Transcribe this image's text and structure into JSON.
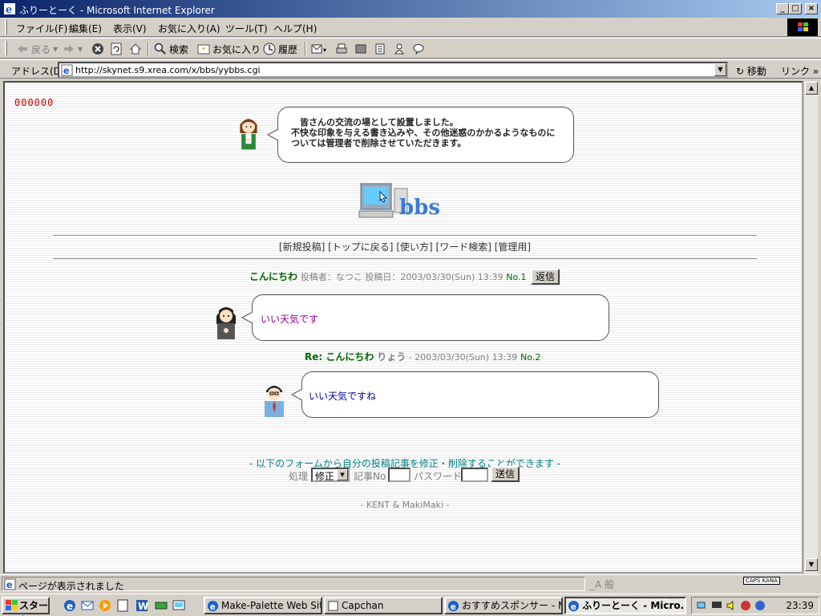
{
  "window": {
    "title": "ふりーとーく - Microsoft Internet Explorer",
    "minimize": "_",
    "maximize": "□",
    "close": "×"
  },
  "menu": [
    "ファイル(F)",
    "編集(E)",
    "表示(V)",
    "お気に入り(A)",
    "ツール(T)",
    "ヘルプ(H)"
  ],
  "toolbar": {
    "back": "戻る",
    "search": "検索",
    "favorites": "お気に入り",
    "history": "履歴"
  },
  "address": {
    "label": "アドレス(D)",
    "url": "http://skynet.s9.xrea.com/x/bbs/yybbs.cgi",
    "go": "移動",
    "links": "リンク »"
  },
  "page": {
    "counter": "000000",
    "welcome": "　皆さんの交流の場として設置しました。\n不快な印象を与える書き込みや、その他迷惑のかかるようなものについては管理者で削除させていただきます。",
    "logo_text": "bbs",
    "nav": [
      "[新規投稿]",
      "[トップに戻る]",
      "[使い方]",
      "[ワード検索]",
      "[管理用]"
    ],
    "posts": [
      {
        "subject": "こんにちわ",
        "meta_label_author": "投稿者：",
        "author": "なつこ",
        "meta_label_date": " 投稿日：",
        "date": "2003/03/30(Sun) 13:39",
        "no": "No.1",
        "reply_button": "返信",
        "message": "いい天気です",
        "message_color": "#990099"
      },
      {
        "subject": "Re: こんにちわ",
        "author": "りょう",
        "date": " - 2003/03/30(Sun) 13:39",
        "no": "No.2",
        "message": "いい天気ですね",
        "message_color": "#000099"
      }
    ],
    "form": {
      "title": "- 以下のフォームから自分の投稿記事を修正・削除することができます -",
      "action_label": "処理",
      "action_value": "修正",
      "article_label": "記事No",
      "password_label": "パスワード",
      "submit": "送信"
    },
    "footer": "- KENT & MakiMaki -"
  },
  "status": {
    "text": "ページが表示されました",
    "ime": "_A 般",
    "caps": "CAPS KANA"
  },
  "taskbar": {
    "start": "スタート",
    "tasks": [
      "Make-Palette Web Site...",
      "Capchan",
      "おすすめスポンサー - Mi...",
      "ふりーとーく - Micro..."
    ],
    "clock": "23:39"
  },
  "colors": {
    "subject": "#006600",
    "counter": "#cc0000",
    "form_title": "#008080"
  }
}
